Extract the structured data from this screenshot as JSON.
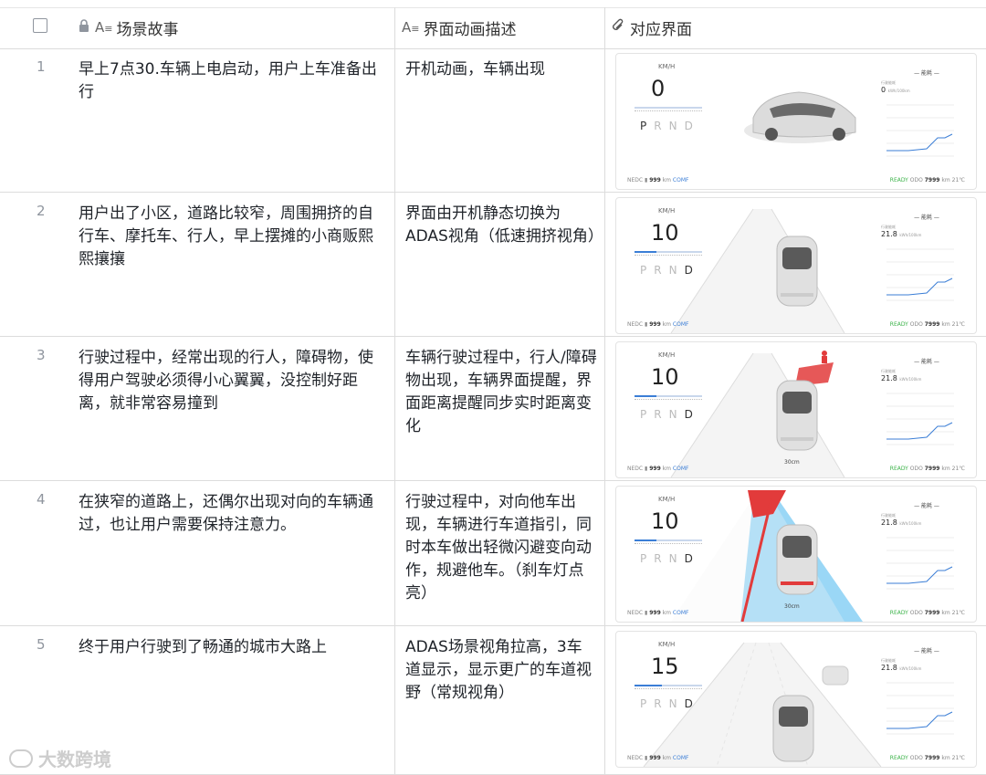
{
  "header": {
    "col1": "场景故事",
    "col2": "界面动画描述",
    "col3": "对应界面"
  },
  "rows": [
    {
      "index": "1",
      "story": "早上7点30.车辆上电启动，用户上车准备出行",
      "animation": "开机动画，车辆出现",
      "screen": {
        "unit": "KM/H",
        "speed": "0",
        "gears": [
          "P",
          "R",
          "N",
          "D"
        ],
        "active_gear": "P",
        "range_label": "NEDC",
        "range": "999",
        "range_unit": "km",
        "mode": "COMF",
        "status": "READY",
        "odo_label": "ODO",
        "odo": "7999",
        "odo_unit": "km",
        "temp": "21℃",
        "energy_title": "能耗",
        "energy_label": "行驶能耗",
        "energy_val": "0",
        "energy_unit": "kWh/100km",
        "distance": ""
      }
    },
    {
      "index": "2",
      "story": "用户出了小区，道路比较窄，周围拥挤的自行车、摩托车、行人，早上摆摊的小商贩熙熙攘攘",
      "animation": "界面由开机静态切换为ADAS视角（低速拥挤视角）",
      "screen": {
        "unit": "KM/H",
        "speed": "10",
        "gears": [
          "P",
          "R",
          "N",
          "D"
        ],
        "active_gear": "D",
        "range_label": "NEDC",
        "range": "999",
        "range_unit": "km",
        "mode": "COMF",
        "status": "READY",
        "odo_label": "ODO",
        "odo": "7999",
        "odo_unit": "km",
        "temp": "21℃",
        "energy_title": "能耗",
        "energy_label": "行驶能耗",
        "energy_val": "21.8",
        "energy_unit": "kWh/100km",
        "distance": ""
      }
    },
    {
      "index": "3",
      "story": "行驶过程中，经常出现的行人，障碍物，使得用户驾驶必须得小心翼翼，没控制好距离，就非常容易撞到",
      "animation": "车辆行驶过程中，行人/障碍物出现，车辆界面提醒，界面距离提醒同步实时距离变化",
      "screen": {
        "unit": "KM/H",
        "speed": "10",
        "gears": [
          "P",
          "R",
          "N",
          "D"
        ],
        "active_gear": "D",
        "range_label": "NEDC",
        "range": "999",
        "range_unit": "km",
        "mode": "COMF",
        "status": "READY",
        "odo_label": "ODO",
        "odo": "7999",
        "odo_unit": "km",
        "temp": "21℃",
        "energy_title": "能耗",
        "energy_label": "行驶能耗",
        "energy_val": "21.8",
        "energy_unit": "kWh/100km",
        "distance": "30cm"
      }
    },
    {
      "index": "4",
      "story": "在狭窄的道路上，还偶尔出现对向的车辆通过，也让用户需要保持注意力。",
      "animation": "行驶过程中，对向他车出现，车辆进行车道指引，同时本车做出轻微闪避变向动作，规避他车。（刹车灯点亮）",
      "screen": {
        "unit": "KM/H",
        "speed": "10",
        "gears": [
          "P",
          "R",
          "N",
          "D"
        ],
        "active_gear": "D",
        "range_label": "NEDC",
        "range": "999",
        "range_unit": "km",
        "mode": "COMF",
        "status": "READY",
        "odo_label": "ODO",
        "odo": "7999",
        "odo_unit": "km",
        "temp": "21℃",
        "energy_title": "能耗",
        "energy_label": "行驶能耗",
        "energy_val": "21.8",
        "energy_unit": "kWh/100km",
        "distance": "30cm"
      }
    },
    {
      "index": "5",
      "story": "终于用户行驶到了畅通的城市大路上",
      "animation": "ADAS场景视角拉高，3车道显示，显示更广的车道视野（常规视角）",
      "screen": {
        "unit": "KM/H",
        "speed": "15",
        "gears": [
          "P",
          "R",
          "N",
          "D"
        ],
        "active_gear": "D",
        "range_label": "NEDC",
        "range": "999",
        "range_unit": "km",
        "mode": "COMF",
        "status": "READY",
        "odo_label": "ODO",
        "odo": "7999",
        "odo_unit": "km",
        "temp": "21℃",
        "energy_title": "能耗",
        "energy_label": "行驶能耗",
        "energy_val": "21.8",
        "energy_unit": "kWh/100km",
        "distance": ""
      }
    }
  ],
  "watermark": "大数跨境",
  "colors": {
    "accent": "#3b7ed6",
    "ready": "#3cb34a",
    "warning": "#e23b3b",
    "lane_blue": "#8fd3f5"
  }
}
